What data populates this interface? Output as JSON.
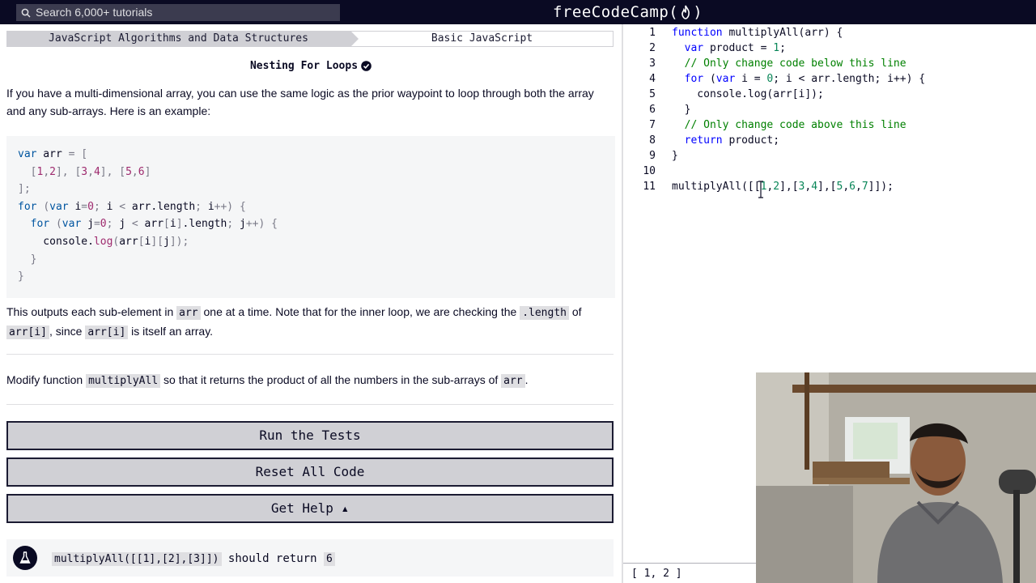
{
  "topbar": {
    "search_placeholder": "Search 6,000+ tutorials",
    "brand_left": "freeCodeCamp(",
    "brand_right": ")"
  },
  "breadcrumb": {
    "section": "JavaScript Algorithms and Data Structures",
    "topic": "Basic JavaScript"
  },
  "challenge": {
    "title": "Nesting For Loops",
    "intro": "If you have a multi-dimensional array, you can use the same logic as the prior waypoint to loop through both the array and any sub-arrays. Here is an example:",
    "explain_1": "This outputs each sub-element in ",
    "explain_code_1": "arr",
    "explain_2": " one at a time. Note that for the inner loop, we are checking the ",
    "explain_code_2": ".length",
    "explain_3": " of ",
    "explain_code_3": "arr[i]",
    "explain_4": ", since ",
    "explain_code_4": "arr[i]",
    "explain_5": " is itself an array.",
    "task_1": "Modify function ",
    "task_code_1": "multiplyAll",
    "task_2": " so that it returns the product of all the numbers in the sub-arrays of ",
    "task_code_2": "arr",
    "task_3": "."
  },
  "buttons": {
    "run": "Run the Tests",
    "reset": "Reset All Code",
    "help": "Get Help ▴"
  },
  "test": {
    "code": "multiplyAll([[1],[2],[3]])",
    "text": " should return ",
    "expected": "6"
  },
  "editor": {
    "line_numbers": [
      "1",
      "2",
      "3",
      "4",
      "5",
      "6",
      "7",
      "8",
      "9",
      "10",
      "11"
    ],
    "lines": [
      "function multiplyAll(arr) {",
      "  var product = 1;",
      "  // Only change code below this line",
      "  for (var i = 0; i < arr.length; i++) {",
      "    console.log(arr[i]);",
      "  }",
      "  // Only change code above this line",
      "  return product;",
      "}",
      "",
      "multiplyAll([[1,2],[3,4],[5,6,7]]);"
    ]
  },
  "console": {
    "output": "[ 1, 2 ]"
  },
  "colors": {
    "nav_bg": "#0a0a23",
    "button_bg": "#d0d0d5",
    "code_bg": "#f5f6f7",
    "keyword": "#0000ff",
    "comment": "#008000"
  }
}
